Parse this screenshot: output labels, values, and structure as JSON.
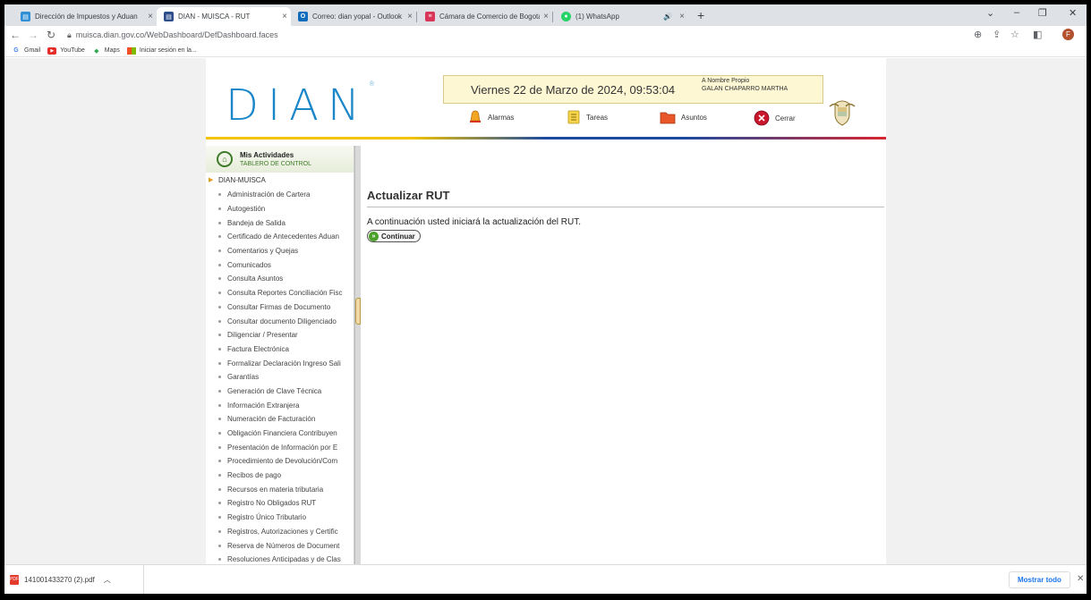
{
  "browser": {
    "tabs": [
      {
        "title": "Dirección de Impuestos y Aduan",
        "favicon_color": "#2e8fd6"
      },
      {
        "title": "DIAN - MUISCA - RUT",
        "favicon_color": "#2d4d8a"
      },
      {
        "title": "Correo: dian yopal - Outlook",
        "favicon_color": "#0f6cbd"
      },
      {
        "title": "Cámara de Comercio de Bogotá",
        "favicon_color": "#d9365a"
      },
      {
        "title": "(1) WhatsApp",
        "favicon_color": "#25d366"
      }
    ],
    "tab_close": "×",
    "new_tab": "+",
    "audio_icon": "🔊",
    "url": "muisca.dian.gov.co/WebDashboard/DefDashboard.faces",
    "profile_initial": "F",
    "bookmarks": [
      {
        "label": "Gmail",
        "icon": "G",
        "color": "#4285f4"
      },
      {
        "label": "YouTube",
        "icon": "▶",
        "color": "#e52d27"
      },
      {
        "label": "Maps",
        "icon": "◆",
        "color": "#34a853"
      },
      {
        "label": "Iniciar sesión en la...",
        "icon": "■",
        "color": "#f4b400"
      }
    ]
  },
  "header": {
    "logo_text": "DIAN",
    "logo_mark": "®",
    "date": "Viernes 22 de Marzo de 2024, 09:53:04",
    "owner_label": "A Nombre Propio",
    "owner_name": "GALAN CHAPARRO MARTHA",
    "actions": [
      {
        "label": "Alarmas",
        "icon": "bell-icon"
      },
      {
        "label": "Tareas",
        "icon": "list-icon"
      },
      {
        "label": "Asuntos",
        "icon": "folder-icon"
      },
      {
        "label": "Cerrar",
        "icon": "close-icon"
      }
    ],
    "colors": {
      "accent_blue": "#1b87c9",
      "stripe_yellow": "#f5c400",
      "stripe_blue": "#1b4aa0",
      "stripe_red": "#d7262f"
    }
  },
  "sidebar": {
    "title": "Mis Actividades",
    "subtitle": "TABLERO DE CONTROL",
    "root": "DIAN-MUISCA",
    "items": [
      "Administración de Cartera",
      "Autogestión",
      "Bandeja de Salida",
      "Certificado de Antecedentes Aduan",
      "Comentarios y Quejas",
      "Comunicados",
      "Consulta Asuntos",
      "Consulta Reportes Conciliación Fisc",
      "Consultar Firmas de Documento",
      "Consultar documento Diligenciado",
      "Diligenciar / Presentar",
      "Factura Electrónica",
      "Formalizar Declaración Ingreso Sali",
      "Garantías",
      "Generación de Clave Técnica",
      "Información Extranjera",
      "Numeración de Facturación",
      "Obligación Financiera Contribuyen",
      "Presentación de Información por E",
      "Procedimiento de Devolución/Com",
      "Recibos de pago",
      "Recursos en materia tributaria",
      "Registro No Obligados RUT",
      "Registro Único Tributario",
      "Registros, Autorizaciones y Certific",
      "Reserva de Números de Document",
      "Resoluciones Anticipadas y de Clas"
    ]
  },
  "content": {
    "title": "Actualizar RUT",
    "message": "A continuación usted iniciará la actualización del RUT.",
    "continue_label": "Continuar"
  },
  "downloads": {
    "file_name": "141001433270 (2).pdf",
    "show_all": "Mostrar todo"
  }
}
